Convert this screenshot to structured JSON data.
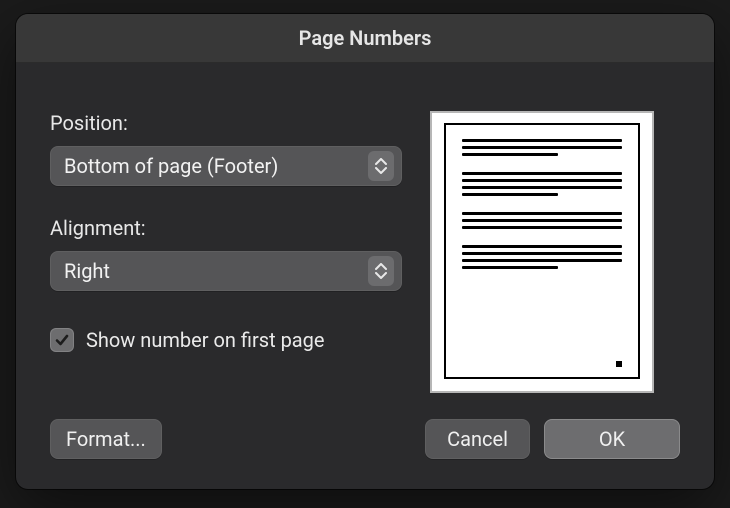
{
  "dialog": {
    "title": "Page Numbers"
  },
  "form": {
    "position_label": "Position:",
    "position_value": "Bottom of page (Footer)",
    "alignment_label": "Alignment:",
    "alignment_value": "Right",
    "show_first_checked": true,
    "show_first_label": "Show number on first page"
  },
  "buttons": {
    "format": "Format...",
    "cancel": "Cancel",
    "ok": "OK"
  }
}
